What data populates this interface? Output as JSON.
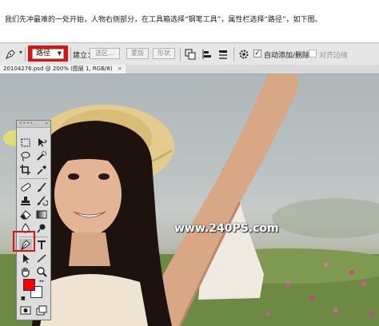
{
  "caption": "我们先冲最难的一处开始，人物右侧部分，在工具箱选择“钢笔工具”，属性栏选择“路径”，如下图。",
  "options_bar": {
    "tool_icon": "pen-tool-icon",
    "mode_value": "路径",
    "build_label": "建立：",
    "selection_button": "选区...",
    "mask_button": "蒙版",
    "shape_button": "形状",
    "auto_add_delete_checked": true,
    "auto_add_delete_label": "自动添加/删除",
    "align_edges_checked": false,
    "align_edges_label": "对齐边缘"
  },
  "document_tab": {
    "title": "20104276.psd @ 200% (图层 1, RGB/8)",
    "close_symbol": "×"
  },
  "canvas": {
    "watermark": "www.240PS.com"
  },
  "toolbox": {
    "foreground_color": "#ff0000",
    "background_color": "#ffffff",
    "active_tool": "pen-tool"
  },
  "colors": {
    "highlight": "#e01010"
  }
}
